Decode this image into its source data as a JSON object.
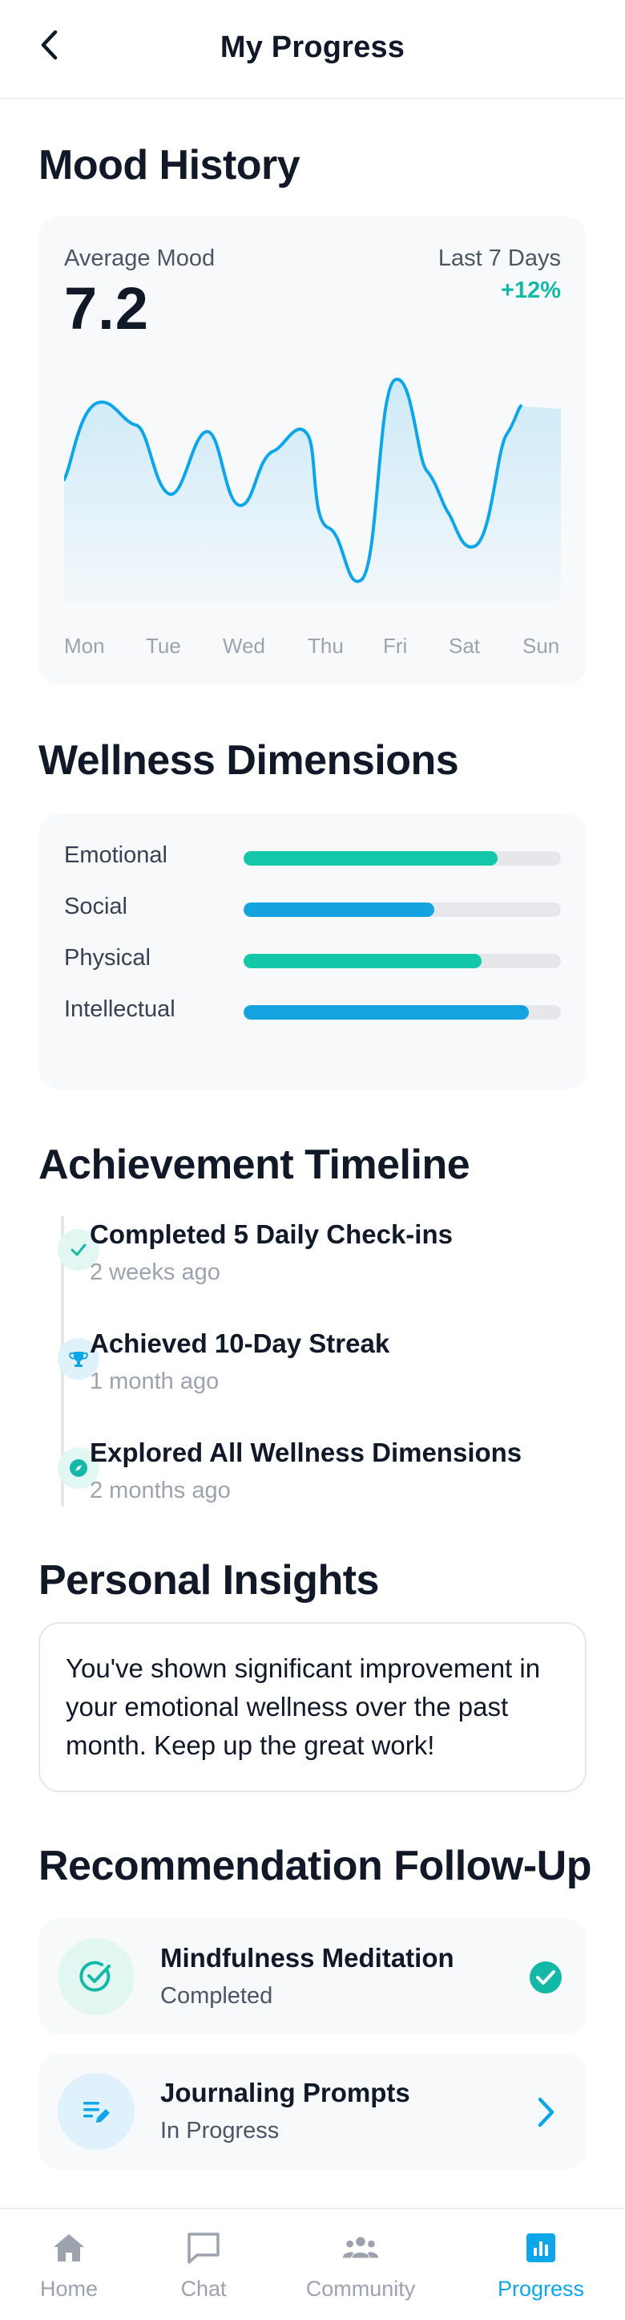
{
  "header": {
    "title": "My Progress",
    "back_icon": "chevron-left-icon"
  },
  "mood": {
    "section_title": "Mood History",
    "avg_label": "Average Mood",
    "avg_value": "7.2",
    "range_label": "Last 7 Days",
    "change": "+12%",
    "days": [
      "Mon",
      "Tue",
      "Wed",
      "Thu",
      "Fri",
      "Sat",
      "Sun"
    ],
    "color": "#0ea5e9"
  },
  "wellness": {
    "section_title": "Wellness Dimensions",
    "items": [
      {
        "label": "Emotional",
        "value": 0.8,
        "color": "#14c7a8"
      },
      {
        "label": "Social",
        "value": 0.6,
        "color": "#14a3e0"
      },
      {
        "label": "Physical",
        "value": 0.75,
        "color": "#14c7a8"
      },
      {
        "label": "Intellectual",
        "value": 0.9,
        "color": "#14a3e0"
      }
    ]
  },
  "timeline": {
    "section_title": "Achievement Timeline",
    "items": [
      {
        "title": "Completed 5 Daily Check-ins",
        "time": "2 weeks ago",
        "icon": "check-icon"
      },
      {
        "title": "Achieved 10-Day Streak",
        "time": "1 month ago",
        "icon": "trophy-icon"
      },
      {
        "title": "Explored All Wellness Dimensions",
        "time": "2 months ago",
        "icon": "compass-icon"
      }
    ]
  },
  "insights": {
    "section_title": "Personal Insights",
    "text": "You've shown significant improvement in your emotional wellness over the past month. Keep up the great work!"
  },
  "recommendations": {
    "section_title": "Recommendation Follow-Up",
    "items": [
      {
        "title": "Mindfulness Meditation",
        "status": "Completed",
        "icon": "check-circle-icon",
        "action_icon": "check-badge-icon"
      },
      {
        "title": "Journaling Prompts",
        "status": "In Progress",
        "icon": "edit-list-icon",
        "action_icon": "chevron-right-icon"
      }
    ]
  },
  "nav": {
    "items": [
      {
        "label": "Home",
        "icon": "home-icon"
      },
      {
        "label": "Chat",
        "icon": "chat-icon"
      },
      {
        "label": "Community",
        "icon": "community-icon"
      },
      {
        "label": "Progress",
        "icon": "bar-chart-icon"
      }
    ],
    "active": "Progress",
    "active_color": "#0ea5e9"
  }
}
